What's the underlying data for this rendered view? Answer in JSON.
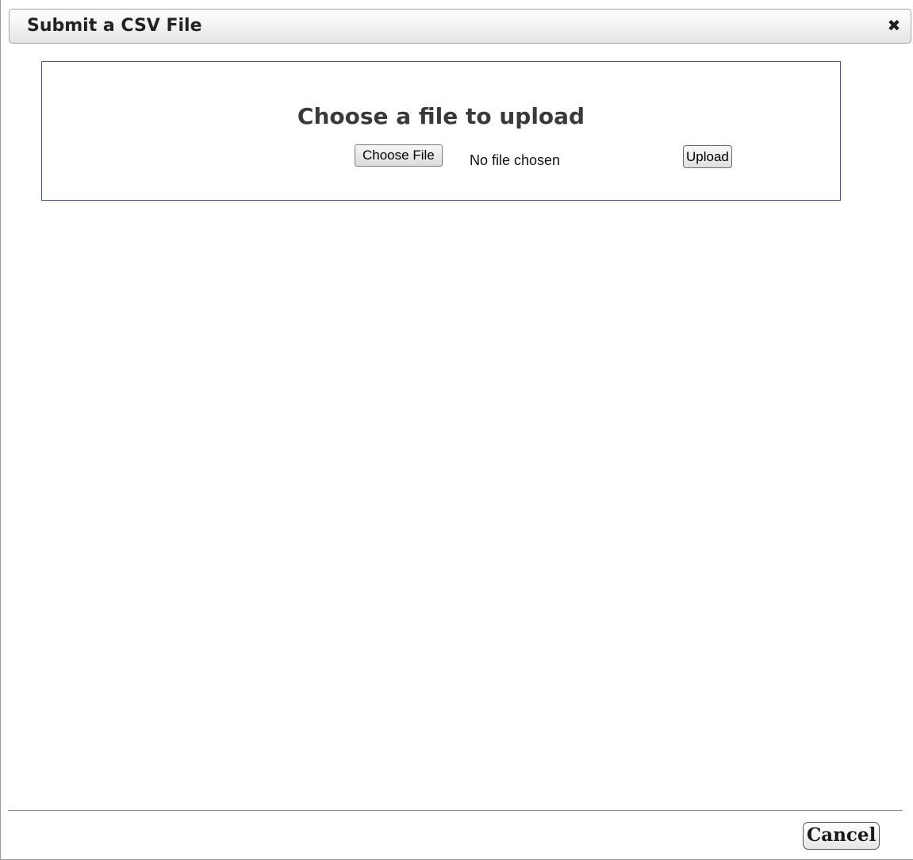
{
  "dialog": {
    "title": "Submit a CSV File",
    "close_glyph": "✖"
  },
  "upload": {
    "heading": "Choose a file to upload",
    "choose_file_label": "Choose File",
    "file_status": "No file chosen",
    "upload_label": "Upload"
  },
  "footer": {
    "cancel_label": "Cancel"
  }
}
